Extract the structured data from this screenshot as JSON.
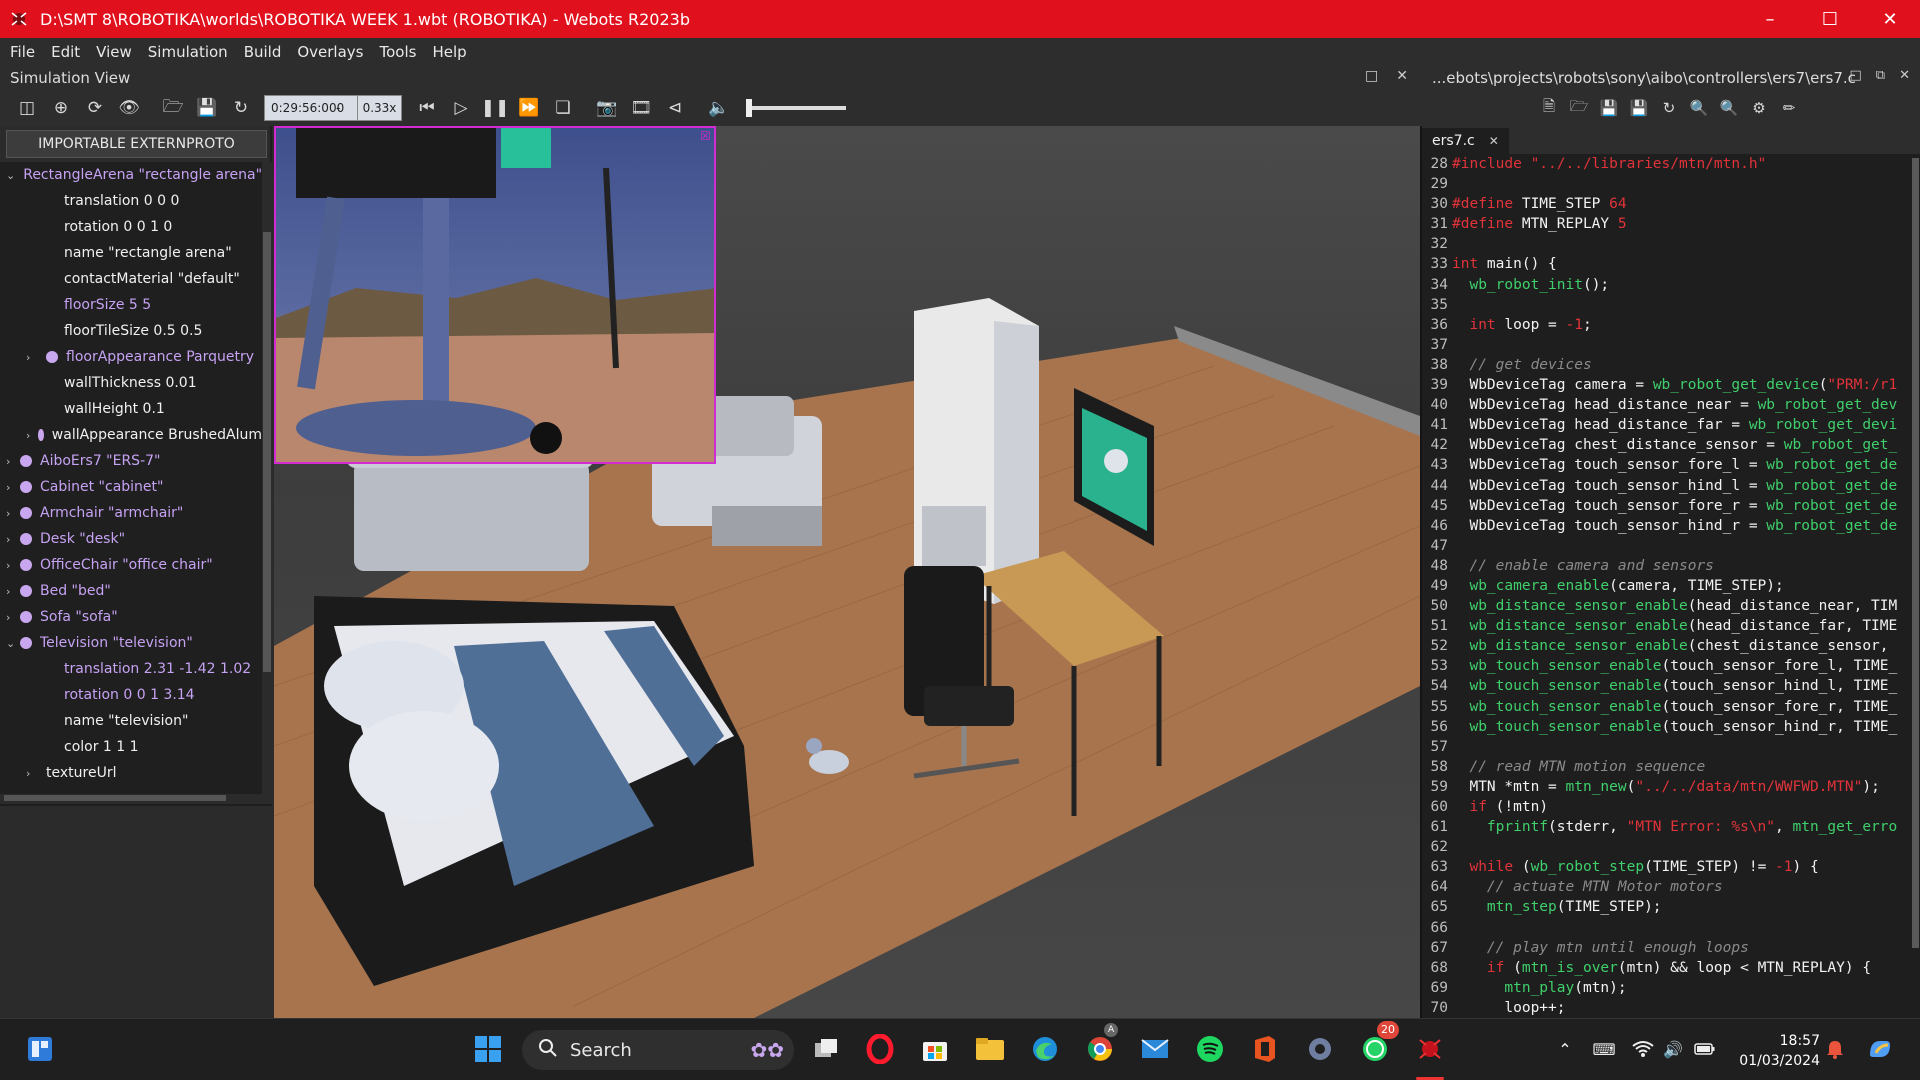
{
  "window": {
    "title": "D:\\SMT 8\\ROBOTIKA\\worlds\\ROBOTIKA WEEK 1.wbt (ROBOTIKA) - Webots R2023b",
    "controls": [
      "minimize",
      "maximize",
      "close"
    ]
  },
  "menu": [
    "File",
    "Edit",
    "View",
    "Simulation",
    "Build",
    "Overlays",
    "Tools",
    "Help"
  ],
  "simulation_view": {
    "title": "Simulation View",
    "time": "0:29:56:000",
    "separator": "-",
    "speed": "0.33x"
  },
  "editor_panel": {
    "path": "...ebots\\projects\\robots\\sony\\aibo\\controllers\\ers7\\ers7.c",
    "tab": "ers7.c"
  },
  "scene_tree": {
    "import_button": "IMPORTABLE EXTERNPROTO",
    "nodes": [
      {
        "label": "RectangleArena \"rectangle arena\"",
        "level": 0,
        "expanded": true,
        "dot": true,
        "color": "lilac"
      },
      {
        "label": "translation 0 0 0",
        "level": 1,
        "color": "white"
      },
      {
        "label": "rotation 0 0 1 0",
        "level": 1,
        "color": "white"
      },
      {
        "label": "name \"rectangle arena\"",
        "level": 1,
        "color": "white"
      },
      {
        "label": "contactMaterial \"default\"",
        "level": 1,
        "color": "white"
      },
      {
        "label": "floorSize 5 5",
        "level": 1,
        "color": "lilac"
      },
      {
        "label": "floorTileSize 0.5 0.5",
        "level": 1,
        "color": "white"
      },
      {
        "label": "floorAppearance Parquetry",
        "level": 1,
        "children": true,
        "dot": true,
        "color": "lilac"
      },
      {
        "label": "wallThickness 0.01",
        "level": 1,
        "color": "white"
      },
      {
        "label": "wallHeight 0.1",
        "level": 1,
        "color": "white"
      },
      {
        "label": "wallAppearance BrushedAlum",
        "level": 1,
        "children": true,
        "dot": true,
        "color": "white"
      },
      {
        "label": "AiboErs7 \"ERS-7\"",
        "level": 0,
        "dot": true,
        "color": "lilac"
      },
      {
        "label": "Cabinet \"cabinet\"",
        "level": 0,
        "dot": true,
        "color": "lilac"
      },
      {
        "label": "Armchair \"armchair\"",
        "level": 0,
        "dot": true,
        "color": "lilac"
      },
      {
        "label": "Desk \"desk\"",
        "level": 0,
        "dot": true,
        "color": "lilac"
      },
      {
        "label": "OfficeChair \"office chair\"",
        "level": 0,
        "dot": true,
        "color": "lilac"
      },
      {
        "label": "Bed \"bed\"",
        "level": 0,
        "dot": true,
        "color": "lilac"
      },
      {
        "label": "Sofa \"sofa\"",
        "level": 0,
        "dot": true,
        "color": "lilac"
      },
      {
        "label": "Television \"television\"",
        "level": 0,
        "expanded": true,
        "dot": true,
        "color": "lilac"
      },
      {
        "label": "translation 2.31 -1.42 1.02",
        "level": 1,
        "color": "lilac"
      },
      {
        "label": "rotation 0 0 1 3.14",
        "level": 1,
        "color": "lilac"
      },
      {
        "label": "name \"television\"",
        "level": 1,
        "color": "white"
      },
      {
        "label": "color 1 1 1",
        "level": 1,
        "color": "white"
      },
      {
        "label": "textureUrl",
        "level": 1,
        "children": true,
        "color": "white"
      }
    ]
  },
  "code": [
    {
      "n": "28",
      "t": "#include \"../../libraries/mtn/mtn.h\""
    },
    {
      "n": "29",
      "t": ""
    },
    {
      "n": "30",
      "t": "#define TIME_STEP 64"
    },
    {
      "n": "31",
      "t": "#define MTN_REPLAY 5"
    },
    {
      "n": "32",
      "t": ""
    },
    {
      "n": "33",
      "t": "int main() {"
    },
    {
      "n": "34",
      "t": "  wb_robot_init();"
    },
    {
      "n": "35",
      "t": ""
    },
    {
      "n": "36",
      "t": "  int loop = -1;"
    },
    {
      "n": "37",
      "t": ""
    },
    {
      "n": "38",
      "t": "  // get devices"
    },
    {
      "n": "39",
      "t": "  WbDeviceTag camera = wb_robot_get_device(\"PRM:/r1"
    },
    {
      "n": "40",
      "t": "  WbDeviceTag head_distance_near = wb_robot_get_dev"
    },
    {
      "n": "41",
      "t": "  WbDeviceTag head_distance_far = wb_robot_get_devi"
    },
    {
      "n": "42",
      "t": "  WbDeviceTag chest_distance_sensor = wb_robot_get_"
    },
    {
      "n": "43",
      "t": "  WbDeviceTag touch_sensor_fore_l = wb_robot_get_de"
    },
    {
      "n": "44",
      "t": "  WbDeviceTag touch_sensor_hind_l = wb_robot_get_de"
    },
    {
      "n": "45",
      "t": "  WbDeviceTag touch_sensor_fore_r = wb_robot_get_de"
    },
    {
      "n": "46",
      "t": "  WbDeviceTag touch_sensor_hind_r = wb_robot_get_de"
    },
    {
      "n": "47",
      "t": ""
    },
    {
      "n": "48",
      "t": "  // enable camera and sensors"
    },
    {
      "n": "49",
      "t": "  wb_camera_enable(camera, TIME_STEP);"
    },
    {
      "n": "50",
      "t": "  wb_distance_sensor_enable(head_distance_near, TIM"
    },
    {
      "n": "51",
      "t": "  wb_distance_sensor_enable(head_distance_far, TIME"
    },
    {
      "n": "52",
      "t": "  wb_distance_sensor_enable(chest_distance_sensor, "
    },
    {
      "n": "53",
      "t": "  wb_touch_sensor_enable(touch_sensor_fore_l, TIME_"
    },
    {
      "n": "54",
      "t": "  wb_touch_sensor_enable(touch_sensor_hind_l, TIME_"
    },
    {
      "n": "55",
      "t": "  wb_touch_sensor_enable(touch_sensor_fore_r, TIME_"
    },
    {
      "n": "56",
      "t": "  wb_touch_sensor_enable(touch_sensor_hind_r, TIME_"
    },
    {
      "n": "57",
      "t": ""
    },
    {
      "n": "58",
      "t": "  // read MTN motion sequence"
    },
    {
      "n": "59",
      "t": "  MTN *mtn = mtn_new(\"../../data/mtn/WWFWD.MTN\");"
    },
    {
      "n": "60",
      "t": "  if (!mtn)"
    },
    {
      "n": "61",
      "t": "    fprintf(stderr, \"MTN Error: %s\\n\", mtn_get_erro"
    },
    {
      "n": "62",
      "t": ""
    },
    {
      "n": "63",
      "t": "  while (wb_robot_step(TIME_STEP) != -1) {"
    },
    {
      "n": "64",
      "t": "    // actuate MTN Motor motors"
    },
    {
      "n": "65",
      "t": "    mtn_step(TIME_STEP);"
    },
    {
      "n": "66",
      "t": ""
    },
    {
      "n": "67",
      "t": "    // play mtn until enough loops"
    },
    {
      "n": "68",
      "t": "    if (mtn_is_over(mtn) && loop < MTN_REPLAY) {"
    },
    {
      "n": "69",
      "t": "      mtn_play(mtn);"
    },
    {
      "n": "70",
      "t": "      loop++;"
    }
  ],
  "taskbar": {
    "search_label": "Search",
    "time": "18:57",
    "date": "01/03/2024",
    "whatsapp_badge": "20",
    "chrome_badge": "A"
  },
  "colors": {
    "title_bar": "#e0101c",
    "tree_lilac": "#c6a2f3",
    "code_keyword": "#e0333a",
    "code_function": "#3fcf6b",
    "code_string": "#e0333a",
    "code_comment": "#8a8a8a",
    "camera_border": "#d12bd1"
  }
}
